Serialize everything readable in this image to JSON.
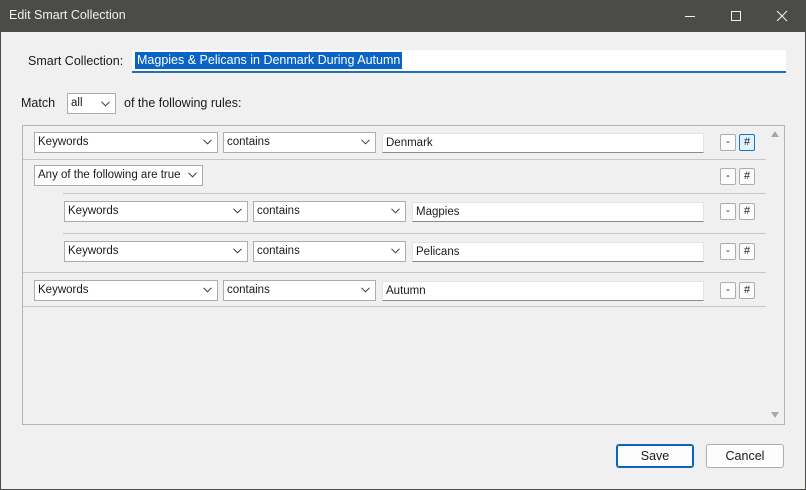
{
  "window": {
    "title": "Edit Smart Collection"
  },
  "collection": {
    "label": "Smart Collection:",
    "name": "Magpies & Pelicans in Denmark During Autumn"
  },
  "match": {
    "label": "Match",
    "value": "all",
    "suffix": "of the following rules:"
  },
  "rules": {
    "rule1": {
      "field": "Keywords",
      "operator": "contains",
      "value": "Denmark"
    },
    "group": {
      "mode": "Any of the following are true",
      "rule1": {
        "field": "Keywords",
        "operator": "contains",
        "value": "Magpies"
      },
      "rule2": {
        "field": "Keywords",
        "operator": "contains",
        "value": "Pelicans"
      }
    },
    "rule3": {
      "field": "Keywords",
      "operator": "contains",
      "value": "Autumn"
    }
  },
  "row_buttons": {
    "remove": "-",
    "add": "#"
  },
  "buttons": {
    "save": "Save",
    "cancel": "Cancel"
  }
}
